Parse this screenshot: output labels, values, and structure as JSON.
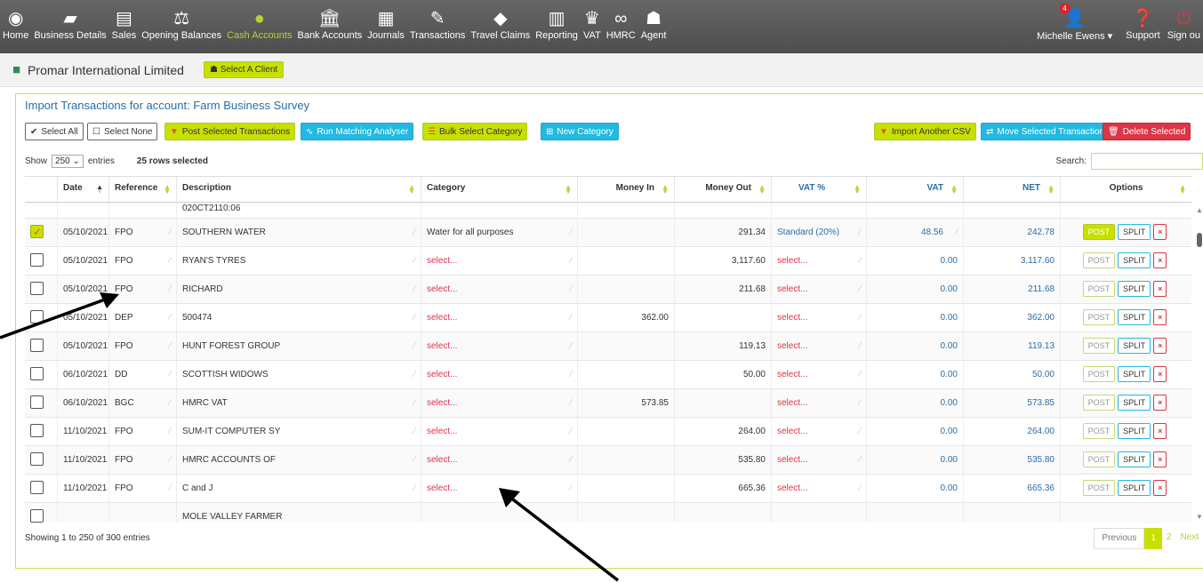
{
  "nav": {
    "items": [
      {
        "label": "Home",
        "icon": "home-icon",
        "glyph": "◉"
      },
      {
        "label": "Business Details",
        "icon": "briefcase-icon",
        "glyph": "▰"
      },
      {
        "label": "Sales",
        "icon": "document-icon",
        "glyph": "▤"
      },
      {
        "label": "Opening Balances",
        "icon": "scales-icon",
        "glyph": "⚖"
      },
      {
        "label": "Cash Accounts",
        "icon": "piggy-bank-icon",
        "glyph": "●"
      },
      {
        "label": "Bank Accounts",
        "icon": "bank-icon",
        "glyph": "🏛"
      },
      {
        "label": "Journals",
        "icon": "calculator-icon",
        "glyph": "▦"
      },
      {
        "label": "Transactions",
        "icon": "edit-icon",
        "glyph": "✎"
      },
      {
        "label": "Travel Claims",
        "icon": "car-icon",
        "glyph": "◆"
      },
      {
        "label": "Reporting",
        "icon": "chart-icon",
        "glyph": "▥"
      },
      {
        "label": "VAT",
        "icon": "crown-icon",
        "glyph": "♛"
      },
      {
        "label": "HMRC",
        "icon": "link-icon",
        "glyph": "∞"
      },
      {
        "label": "Agent",
        "icon": "users-icon",
        "glyph": "☗"
      }
    ],
    "active": "Cash Accounts",
    "user": "Michelle Ewens",
    "notif_count": "4",
    "support": "Support",
    "signout": "Sign ou"
  },
  "client": {
    "name": "Promar International Limited",
    "select_label": "Select A Client"
  },
  "panel": {
    "title": "Import Transactions for account: Farm Business Survey",
    "buttons": {
      "select_all": "Select All",
      "select_none": "Select None",
      "post_selected": "Post Selected Transactions",
      "run_matching": "Run Matching Analyser",
      "bulk_category": "Bulk Select Category",
      "new_category": "New Category",
      "import_csv": "Import Another CSV",
      "move_selected": "Move Selected Transactions",
      "delete_selected": "Delete Selected"
    },
    "show_label": "Show",
    "page_size": "250",
    "entries_label": "entries",
    "rows_selected": "25 rows selected",
    "search_label": "Search:"
  },
  "table": {
    "headers": {
      "date": "Date",
      "reference": "Reference",
      "description": "Description",
      "category": "Category",
      "money_in": "Money In",
      "money_out": "Money Out",
      "vat_pct": "VAT %",
      "vat": "VAT",
      "net": "NET",
      "options": "Options"
    },
    "rows": [
      {
        "checked": false,
        "partial": true,
        "date": "",
        "ref": "",
        "desc": "020CT2110:06",
        "cat": "",
        "in": "",
        "out": "",
        "vatpct": "",
        "vat": "",
        "net": "",
        "postOn": false
      },
      {
        "checked": true,
        "date": "05/10/2021",
        "ref": "FPO",
        "desc": "SOUTHERN WATER",
        "cat": "Water for all purposes",
        "in": "",
        "out": "291.34",
        "vatpct": "Standard (20%)",
        "vat": "48.56",
        "net": "242.78",
        "postOn": true
      },
      {
        "checked": false,
        "date": "05/10/2021",
        "ref": "FPO",
        "desc": "RYAN'S TYRES",
        "cat": "select...",
        "in": "",
        "out": "3,117.60",
        "vatpct": "select...",
        "vat": "0.00",
        "net": "3,117.60",
        "postOn": false
      },
      {
        "checked": false,
        "date": "05/10/2021",
        "ref": "FPO",
        "desc": "RICHARD",
        "cat": "select...",
        "in": "",
        "out": "211.68",
        "vatpct": "select...",
        "vat": "0.00",
        "net": "211.68",
        "postOn": false
      },
      {
        "checked": false,
        "date": "05/10/2021",
        "ref": "DEP",
        "desc": "500474",
        "cat": "select...",
        "in": "362.00",
        "out": "",
        "vatpct": "select...",
        "vat": "0.00",
        "net": "362.00",
        "postOn": false
      },
      {
        "checked": false,
        "date": "05/10/2021",
        "ref": "FPO",
        "desc": "HUNT FOREST GROUP",
        "cat": "select...",
        "in": "",
        "out": "119.13",
        "vatpct": "select...",
        "vat": "0.00",
        "net": "119.13",
        "postOn": false
      },
      {
        "checked": false,
        "date": "06/10/2021",
        "ref": "DD",
        "desc": "SCOTTISH WIDOWS",
        "cat": "select...",
        "in": "",
        "out": "50.00",
        "vatpct": "select...",
        "vat": "0.00",
        "net": "50.00",
        "postOn": false
      },
      {
        "checked": false,
        "date": "06/10/2021",
        "ref": "BGC",
        "desc": "HMRC VAT",
        "cat": "select...",
        "in": "573.85",
        "out": "",
        "vatpct": "select...",
        "vat": "0.00",
        "net": "573.85",
        "postOn": false
      },
      {
        "checked": false,
        "date": "11/10/2021",
        "ref": "FPO",
        "desc": "SUM-IT COMPUTER SY",
        "cat": "select...",
        "in": "",
        "out": "264.00",
        "vatpct": "select...",
        "vat": "0.00",
        "net": "264.00",
        "postOn": false
      },
      {
        "checked": false,
        "date": "11/10/2021",
        "ref": "FPO",
        "desc": "HMRC ACCOUNTS OF",
        "cat": "select...",
        "in": "",
        "out": "535.80",
        "vatpct": "select...",
        "vat": "0.00",
        "net": "535.80",
        "postOn": false
      },
      {
        "checked": false,
        "date": "11/10/2021",
        "ref": "FPO",
        "desc": "C and J",
        "cat": "select...",
        "in": "",
        "out": "665.36",
        "vatpct": "select...",
        "vat": "0.00",
        "net": "665.36",
        "postOn": false
      },
      {
        "checked": false,
        "date": "",
        "ref": "",
        "desc": "MOLE VALLEY FARMER",
        "cat": "",
        "in": "",
        "out": "",
        "vatpct": "",
        "vat": "",
        "net": "",
        "postOn": false
      }
    ],
    "option_labels": {
      "post": "POST",
      "split": "SPLIT",
      "delete": "×"
    }
  },
  "footer": {
    "showing": "Showing 1 to 250 of 300 entries",
    "pager": {
      "previous": "Previous",
      "pages": [
        "1",
        "2"
      ],
      "current": "1",
      "next": "Next"
    }
  },
  "colors": {
    "accent": "#c8e000",
    "link": "#2a6ea6",
    "danger": "#dc3545",
    "info": "#23b9e0",
    "nav_bg": "#5b5b5b"
  }
}
